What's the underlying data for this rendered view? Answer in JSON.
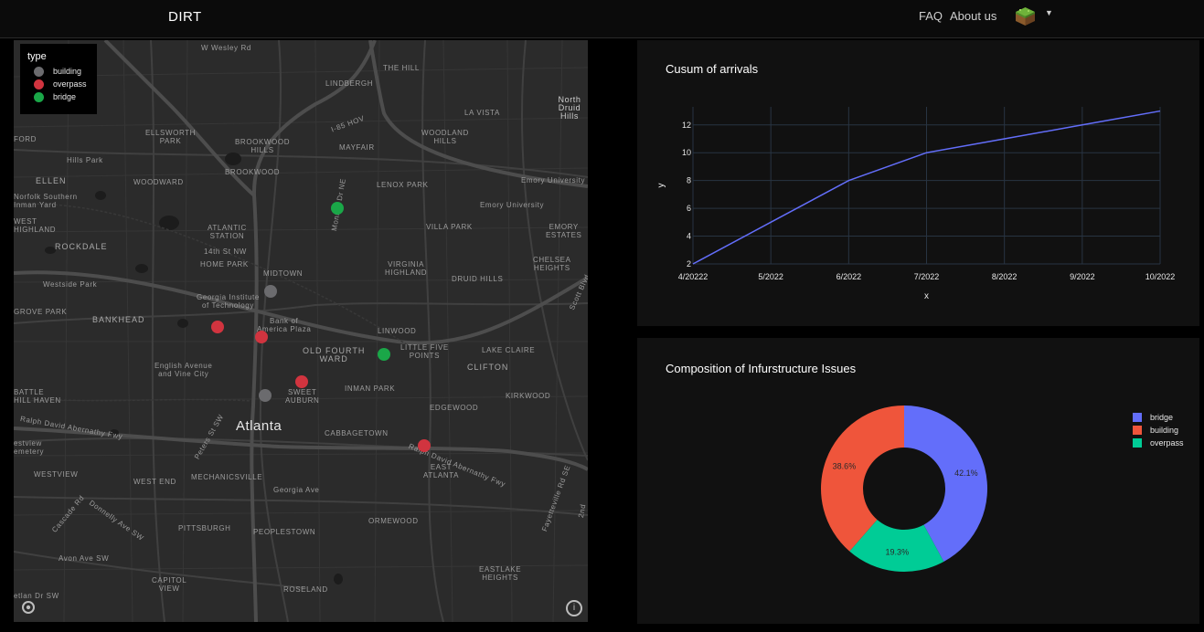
{
  "nav": {
    "brand": "DIRT",
    "links": [
      "FAQ",
      "About us"
    ],
    "avatar_icon": "minecraft-block-avatar",
    "menu_icon": "caret-down-icon"
  },
  "map": {
    "legend": {
      "title": "type",
      "items": [
        {
          "label": "building",
          "color": "#6b6b6e"
        },
        {
          "label": "overpass",
          "color": "#d1343f"
        },
        {
          "label": "bridge",
          "color": "#1aa748"
        }
      ]
    },
    "labels": {
      "w_wesley": "W Wesley Rd",
      "the_hill": "THE HILL",
      "lindbergh": "LINDBERGH",
      "north_druid": "North\nDruid Hills",
      "la_vista": "LA VISTA",
      "ellsworth": "ELLSWORTH\nPARK",
      "brookwood_hills": "BROOKWOOD\nHILLS",
      "mayfair": "MAYFAIR",
      "woodland": "WOODLAND\nHILLS",
      "hills_park": "Hills Park",
      "ford": "FORD",
      "ellen": "ELLEN",
      "woodward": "WOODWARD",
      "brookwood": "BROOKWOOD",
      "lenox_park": "LENOX PARK",
      "emory_univ1": "Emory University",
      "norfolk": "Norfolk Southern\nInman Yard",
      "emory_univ2": "Emory University",
      "west_highland": "WEST\nHIGHLAND",
      "atlantic_station": "ATLANTIC\nSTATION",
      "villa_park": "VILLA PARK",
      "emory_estates": "EMORY\nESTATES",
      "rockdale": "ROCKDALE",
      "st14": "14th St NW",
      "monroe": "Monroe Dr NE",
      "home_park": "HOME PARK",
      "virginia_highland": "VIRGINIA\nHIGHLAND",
      "chelsea": "CHELSEA\nHEIGHTS",
      "midtown": "MIDTOWN",
      "druid_hills": "DRUID HILLS",
      "westside_park": "Westside Park",
      "georgia_tech": "Georgia Institute\nof Technology",
      "scott_blvd": "Scott Blvd",
      "grove_park": "GROVE PARK",
      "bankhead": "BANKHEAD",
      "bank_of_america": "Bank of\nAmerica Plaza",
      "linwood": "LINWOOD",
      "little_five": "LITTLE FIVE\nPOINTS",
      "lake_claire": "LAKE CLAIRE",
      "old_fourth": "OLD FOURTH\nWARD",
      "clifton": "CLIFTON",
      "english_ave": "English Avenue\nand Vine City",
      "sweet_auburn": "SWEET\nAUBURN",
      "inman_park": "INMAN PARK",
      "kirkwood": "KIRKWOOD",
      "battle_hill": "BATTLE\nHILL HAVEN",
      "edgewood": "EDGEWOOD",
      "ralph_aberna": "Ralph David Abernathy Fwy",
      "atlanta": "Atlanta",
      "peters_st": "Peters St SW",
      "cabbagetown": "CABBAGETOWN",
      "westview_cem": "estview\nemetery",
      "ralph_aberna2": "Ralph David Abernathy Fwy",
      "westview": "WESTVIEW",
      "west_end": "WEST END",
      "mechanicsville": "MECHANICSVILLE",
      "east_atlanta": "EAST\nATLANTA",
      "georgia_ave": "Georgia Ave",
      "cascade": "Cascade Rd",
      "donnelly": "Donnelly Ave SW",
      "fayetteville": "Fayetteville Rd SE",
      "ormewood": "ORMEWOOD",
      "pittsburgh": "PITTSBURGH",
      "peoplestown": "PEOPLESTOWN",
      "avon": "Avon Ave SW",
      "east_lake": "EASTLAKE\nHEIGHTS",
      "capitol_view": "CAPITOL\nVIEW",
      "roseland": "ROSELAND",
      "metlan": "etlan Dr SW",
      "i85": "I-85 HOV",
      "zzd": "2nd"
    },
    "points": [
      {
        "type": "bridge",
        "color": "#1aa748"
      },
      {
        "type": "building",
        "color": "#6b6b6e"
      },
      {
        "type": "overpass",
        "color": "#d1343f"
      },
      {
        "type": "overpass",
        "color": "#d1343f"
      },
      {
        "type": "bridge",
        "color": "#1aa748"
      },
      {
        "type": "overpass",
        "color": "#d1343f"
      },
      {
        "type": "building",
        "color": "#6b6b6e"
      },
      {
        "type": "overpass",
        "color": "#d1343f"
      }
    ],
    "controls": {
      "mapbox_logo_icon": "mapbox-logo-icon",
      "info_icon": "info-icon",
      "info_glyph": "i"
    }
  },
  "chart_data": [
    {
      "type": "line",
      "title": "Cusum of arrivals",
      "xlabel": "x",
      "ylabel": "y",
      "categories": [
        "4/20222",
        "5/2022",
        "6/2022",
        "7/2022",
        "8/2022",
        "9/2022",
        "10/2022"
      ],
      "series": [
        {
          "values": [
            2,
            5,
            8,
            10,
            11,
            12,
            13
          ],
          "color": "#636efa"
        }
      ],
      "yticks": [
        2,
        4,
        6,
        8,
        10,
        12
      ],
      "ylim": [
        2,
        13
      ],
      "grid": true
    },
    {
      "type": "pie",
      "title": "Composition of Infurstructure Issues",
      "hole": true,
      "slices": [
        {
          "name": "bridge",
          "value": 42.1,
          "label": "42.1%",
          "color": "#636efa"
        },
        {
          "name": "overpass",
          "value": 19.3,
          "label": "19.3%",
          "color": "#00cc96"
        },
        {
          "name": "building",
          "value": 38.6,
          "label": "38.6%",
          "color": "#ef553b"
        }
      ],
      "legend": [
        {
          "name": "bridge",
          "color": "#636efa"
        },
        {
          "name": "building",
          "color": "#ef553b"
        },
        {
          "name": "overpass",
          "color": "#00cc96"
        }
      ],
      "legend_position": "right"
    }
  ]
}
